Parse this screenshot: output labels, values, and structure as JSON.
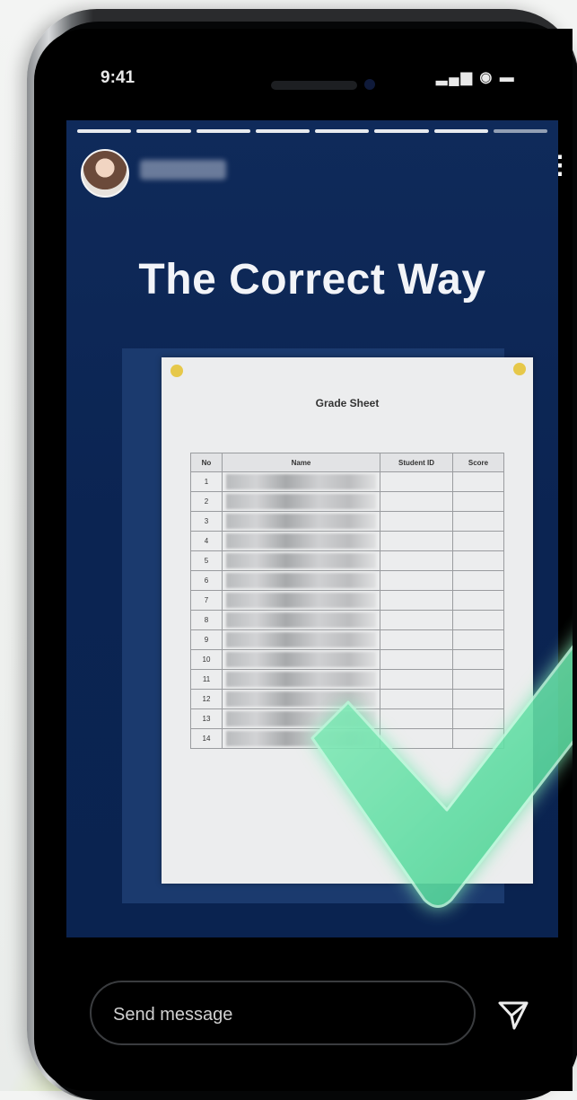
{
  "status_bar": {
    "time": "9:41",
    "icons": "▂▄▆ ◉ ▬"
  },
  "story": {
    "progress_segments": 8,
    "progress_done": 7,
    "username": "username",
    "more_icon": "⋮",
    "title": "The Correct Way"
  },
  "document": {
    "title": "Grade Sheet",
    "subtitle": "",
    "date": "",
    "columns": [
      "No",
      "Name",
      "Student ID",
      "Score"
    ],
    "rows": [
      {
        "no": "1",
        "id": "",
        "score": ""
      },
      {
        "no": "2",
        "id": "",
        "score": ""
      },
      {
        "no": "3",
        "id": "",
        "score": ""
      },
      {
        "no": "4",
        "id": "",
        "score": ""
      },
      {
        "no": "5",
        "id": "",
        "score": ""
      },
      {
        "no": "6",
        "id": "",
        "score": ""
      },
      {
        "no": "7",
        "id": "",
        "score": ""
      },
      {
        "no": "8",
        "id": "",
        "score": ""
      },
      {
        "no": "9",
        "id": "",
        "score": ""
      },
      {
        "no": "10",
        "id": "",
        "score": ""
      },
      {
        "no": "11",
        "id": "",
        "score": ""
      },
      {
        "no": "12",
        "id": "",
        "score": ""
      },
      {
        "no": "13",
        "id": "",
        "score": ""
      },
      {
        "no": "14",
        "id": "",
        "score": ""
      }
    ]
  },
  "composer": {
    "placeholder": "Send message"
  },
  "icons": {
    "send": "send-icon",
    "checkmark": "checkmark-icon"
  },
  "colors": {
    "story_bg": "#0b2452",
    "check_green": "#6fe3a8",
    "glow": "#d6f53c"
  }
}
